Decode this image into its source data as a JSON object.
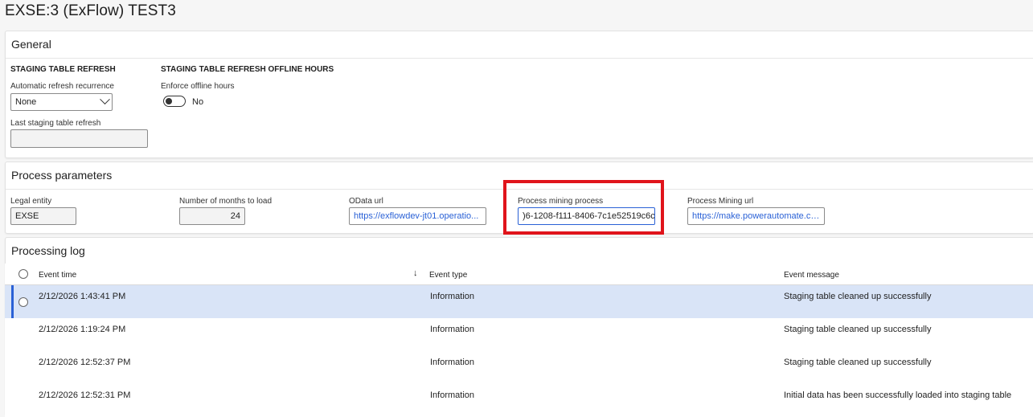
{
  "page": {
    "title": "EXSE:3 (ExFlow) TEST3"
  },
  "general": {
    "header": "General",
    "staging_group_title": "STAGING TABLE REFRESH",
    "offline_group_title": "STAGING TABLE REFRESH OFFLINE HOURS",
    "auto_refresh_label": "Automatic refresh recurrence",
    "auto_refresh_value": "None",
    "enforce_label": "Enforce offline hours",
    "enforce_value": "No",
    "enforce_on": false,
    "last_refresh_label": "Last staging table refresh",
    "last_refresh_value": ""
  },
  "params": {
    "header": "Process parameters",
    "legal_entity_label": "Legal entity",
    "legal_entity_value": "EXSE",
    "months_label": "Number of months to load",
    "months_value": "24",
    "odata_label": "OData url",
    "odata_value": "https://exflowdev-jt01.operatio...",
    "pm_process_label": "Process mining process",
    "pm_process_value": ")6-1208-f111-8406-7c1e52519c6c",
    "pm_url_label": "Process Mining url",
    "pm_url_value": "https://make.powerautomate.co..."
  },
  "log": {
    "header": "Processing log",
    "col_time": "Event time",
    "col_type": "Event type",
    "col_message": "Event message",
    "sort_icon": "↓",
    "rows": [
      {
        "time": "2/12/2026 1:43:41 PM",
        "type": "Information",
        "message": "Staging table cleaned up successfully"
      },
      {
        "time": "2/12/2026 1:19:24 PM",
        "type": "Information",
        "message": "Staging table cleaned up successfully"
      },
      {
        "time": "2/12/2026 12:52:37 PM",
        "type": "Information",
        "message": "Staging table cleaned up successfully"
      },
      {
        "time": "2/12/2026 12:52:31 PM",
        "type": "Information",
        "message": "Initial data has been successfully loaded into staging table"
      }
    ]
  },
  "colors": {
    "accent": "#2a61d6",
    "highlight": "#e0141b",
    "selected_row": "#d9e4f7"
  }
}
